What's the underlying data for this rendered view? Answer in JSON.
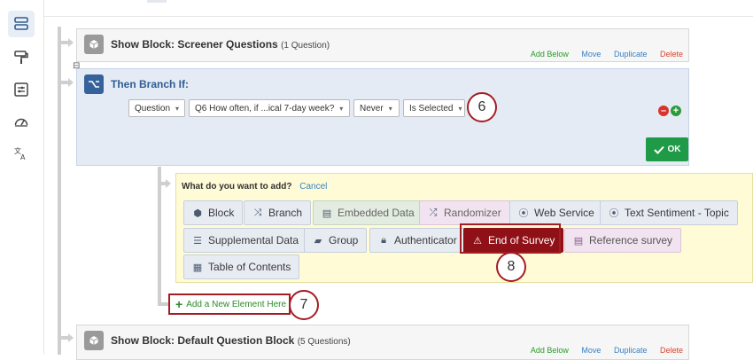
{
  "rail": {
    "icons": [
      "survey-flow-icon",
      "paint-roller-icon",
      "options-icon",
      "gauge-icon",
      "translate-icon"
    ]
  },
  "blocks": {
    "screener": {
      "title": "Show Block: Screener Questions",
      "count": "(1 Question)"
    },
    "default": {
      "title": "Show Block: Default Question Block",
      "count": "(5 Questions)"
    },
    "actions": {
      "add_below": "Add Below",
      "move": "Move",
      "duplicate": "Duplicate",
      "delete": "Delete"
    },
    "collapse_symbol": "⊟"
  },
  "branch": {
    "title": "Then Branch If:",
    "selects": [
      "Question",
      "Q6 How often, if ...ical 7-day week?",
      "Never",
      "Is Selected"
    ],
    "ok_label": "OK",
    "remove_symbol": "–",
    "add_symbol": "+"
  },
  "add_panel": {
    "prompt": "What do you want to add?",
    "cancel": "Cancel",
    "options": [
      {
        "label": "Block",
        "icon": "cube-icon"
      },
      {
        "label": "Branch",
        "icon": "branch-icon"
      },
      {
        "label": "Embedded Data",
        "icon": "embedded-data-icon"
      },
      {
        "label": "Randomizer",
        "icon": "shuffle-icon"
      },
      {
        "label": "Web Service",
        "icon": "web-service-icon"
      },
      {
        "label": "Text Sentiment - Topic",
        "icon": "text-sentiment-icon"
      },
      {
        "label": "Supplemental Data",
        "icon": "database-icon"
      },
      {
        "label": "Group",
        "icon": "folder-icon"
      },
      {
        "label": "Authenticator",
        "icon": "lock-icon"
      },
      {
        "label": "End of Survey",
        "icon": "warning-icon"
      },
      {
        "label": "Reference survey",
        "icon": "clipboard-icon"
      },
      {
        "label": "Table of Contents",
        "icon": "table-of-contents-icon"
      }
    ]
  },
  "new_element": {
    "label": "Add a New Element Here"
  },
  "callouts": {
    "six": "6",
    "seven": "7",
    "eight": "8"
  },
  "colors": {
    "accent_red": "#a31d24",
    "eos_red": "#8f1016",
    "ok_green": "#1f9a47",
    "branch_blue": "#35629b"
  }
}
